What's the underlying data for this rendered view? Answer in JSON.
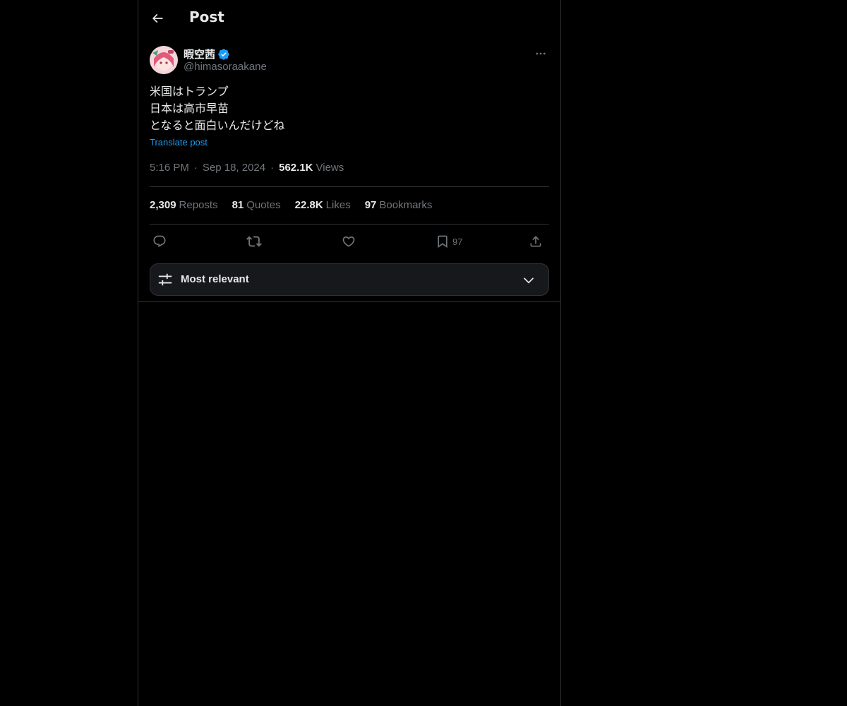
{
  "header": {
    "title": "Post",
    "back_icon": "arrow-left-icon"
  },
  "author": {
    "display_name": "暇空茜",
    "handle": "@himasoraakane",
    "verified": true,
    "verified_color": "#1d9bf0"
  },
  "post": {
    "lines": [
      "米国はトランプ",
      "日本は高市早苗",
      "となると面白いんだけどね"
    ],
    "translate_label": "Translate post",
    "time": "5:16 PM",
    "date": "Sep 18, 2024",
    "views_count": "562.1K",
    "views_label": "Views",
    "separator": "·"
  },
  "stats": {
    "reposts_count": "2,309",
    "reposts_label": "Reposts",
    "quotes_count": "81",
    "quotes_label": "Quotes",
    "likes_count": "22.8K",
    "likes_label": "Likes",
    "bookmarks_count": "97",
    "bookmarks_label": "Bookmarks"
  },
  "actions": {
    "bookmark_count": "97"
  },
  "sort": {
    "label": "Most relevant"
  },
  "colors": {
    "background": "#000000",
    "text": "#e7e9ea",
    "muted": "#71767b",
    "accent": "#1d9bf0",
    "border": "#2f3336"
  }
}
